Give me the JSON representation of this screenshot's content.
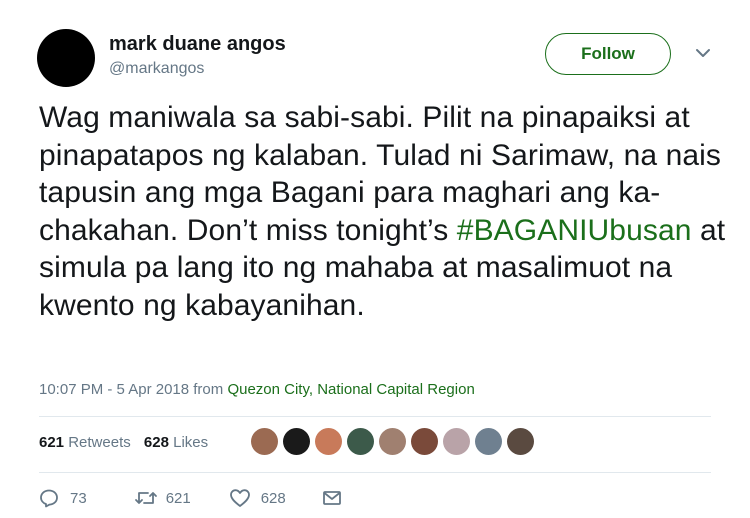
{
  "author": {
    "name": "mark duane angos",
    "handle": "@markangos"
  },
  "follow_label": "Follow",
  "tweet": {
    "text_before": "Wag maniwala sa sabi-sabi. Pilit na pinapaiksi at pinapatapos ng kalaban. Tulad ni Sarimaw, na nais tapusin ang mga Bagani para maghari ang ka-chakahan. Don’t miss tonight’s",
    "hashtag": "#BAGANIUbusan",
    "text_after": "at simula pa lang ito ng mahaba at masalimuot na kwento ng kabayanihan."
  },
  "meta": {
    "timestamp": "10:07 PM - 5 Apr 2018 from",
    "location": "Quezon City, National Capital Region"
  },
  "stats": {
    "retweets_count": "621",
    "retweets_label": "Retweets",
    "likes_count": "628",
    "likes_label": "Likes"
  },
  "likers": [
    {
      "color": "#9b6a52"
    },
    {
      "color": "#1a1a1a"
    },
    {
      "color": "#c87a5a"
    },
    {
      "color": "#3c5a4a"
    },
    {
      "color": "#a08070"
    },
    {
      "color": "#7a4a3a"
    },
    {
      "color": "#b9a3a8"
    },
    {
      "color": "#6f8090"
    },
    {
      "color": "#5a4a40"
    }
  ],
  "actions": {
    "replies": "73",
    "retweets": "621",
    "likes": "628"
  },
  "icons": {
    "reply": "reply-icon",
    "retweet": "retweet-icon",
    "like": "heart-icon",
    "message": "envelope-icon",
    "caret": "chevron-down-icon"
  }
}
